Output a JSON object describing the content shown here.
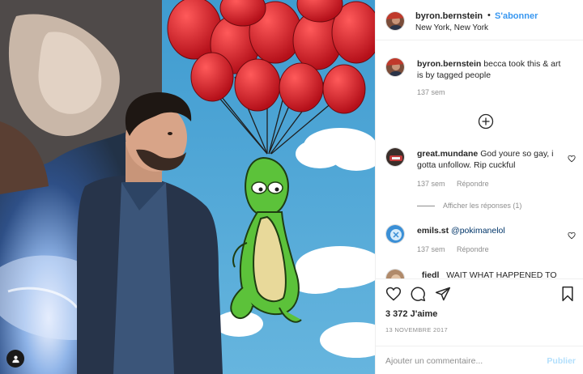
{
  "post": {
    "author": "byron.bernstein",
    "separator": "•",
    "follow_label": "S'abonner",
    "location": "New York, New York"
  },
  "comments": [
    {
      "username": "byron.bernstein",
      "text": "becca took this & art is by tagged people",
      "time": "137 sem",
      "reply_label": ""
    },
    {
      "username": "great.mundane",
      "text": "God youre so gay, i gotta unfollow. Rip cuckful",
      "time": "137 sem",
      "reply_label": "Répondre"
    },
    {
      "username": "emils.st",
      "text": "@pokimanelol",
      "time": "137 sem",
      "reply_label": "Répondre"
    },
    {
      "username": "_fiedl_",
      "text": "WAIT WHAT HAPPENED TO",
      "time": "",
      "reply_label": ""
    }
  ],
  "view_replies_label": "Afficher les réponses (1)",
  "likes_label": "3 372 J'aime",
  "date_label": "13 NOVEMBRE 2017",
  "comment_input": {
    "placeholder": "Ajouter un commentaire...",
    "value": ""
  },
  "publish_label": "Publier",
  "icons": [
    "user-tag-icon",
    "plus-circle-icon",
    "heart-icon",
    "comment-icon",
    "share-icon",
    "bookmark-icon"
  ],
  "colors": {
    "link": "#3897f0",
    "publish_disabled": "#b2dffc",
    "muted": "#8e8e8e",
    "text": "#262626"
  }
}
